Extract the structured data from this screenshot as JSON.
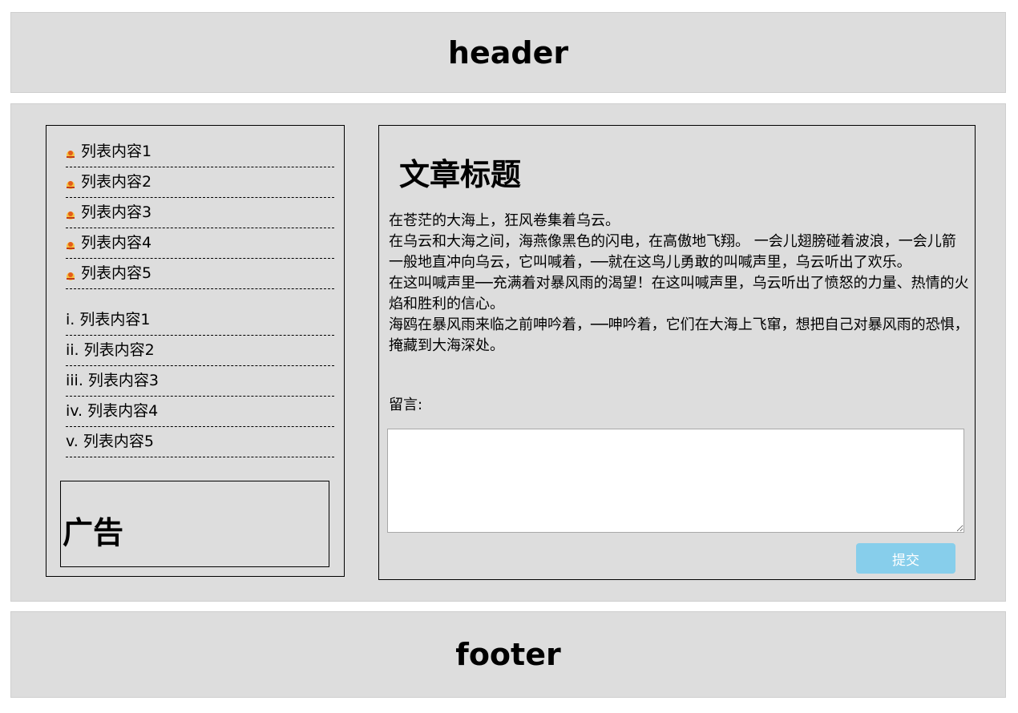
{
  "header": {
    "title": "header"
  },
  "footer": {
    "title": "footer"
  },
  "sidebar": {
    "bullet_list": [
      {
        "label": "列表内容1"
      },
      {
        "label": "列表内容2"
      },
      {
        "label": "列表内容3"
      },
      {
        "label": "列表内容4"
      },
      {
        "label": "列表内容5"
      }
    ],
    "roman_list": [
      {
        "marker": "i.",
        "label": "列表内容1"
      },
      {
        "marker": "ii.",
        "label": "列表内容2"
      },
      {
        "marker": "iii.",
        "label": "列表内容3"
      },
      {
        "marker": "iv.",
        "label": "列表内容4"
      },
      {
        "marker": "v.",
        "label": "列表内容5"
      }
    ],
    "ad": {
      "title": "广告"
    }
  },
  "article": {
    "title": "文章标题",
    "paragraphs": [
      "在苍茫的大海上，狂风卷集着乌云。",
      "在乌云和大海之间，海燕像黑色的闪电，在高傲地飞翔。 一会儿翅膀碰着波浪，一会儿箭一般地直冲向乌云，它叫喊着，──就在这鸟儿勇敢的叫喊声里，乌云听出了欢乐。",
      "在这叫喊声里──充满着对暴风雨的渴望！在这叫喊声里，乌云听出了愤怒的力量、热情的火焰和胜利的信心。",
      "海鸥在暴风雨来临之前呻吟着，──呻吟着，它们在大海上飞窜，想把自己对暴风雨的恐惧，掩藏到大海深处。"
    ],
    "comment_label": "留言:",
    "comment_value": "",
    "submit_label": "提交"
  },
  "colors": {
    "panel_bg": "#dddddd",
    "submit_bg": "#87ceeb",
    "bullet_icon": "#e8a317"
  },
  "icons": {
    "bullet": "flower-bullet-icon"
  }
}
